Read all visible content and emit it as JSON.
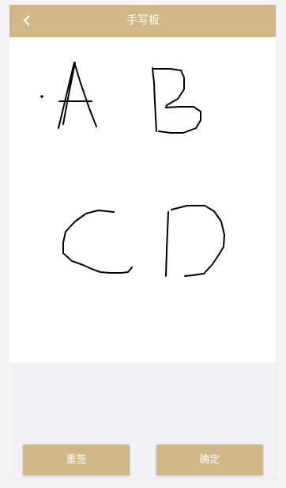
{
  "header": {
    "title": "手写板",
    "back_icon": "chevron-left-icon"
  },
  "signature_pad": {
    "ink_color": "#000000",
    "background": "#ffffff"
  },
  "actions": {
    "reset_label": "重签",
    "confirm_label": "确定"
  },
  "colors": {
    "accent": "#cfb787",
    "page_background": "#f0f2f7"
  }
}
